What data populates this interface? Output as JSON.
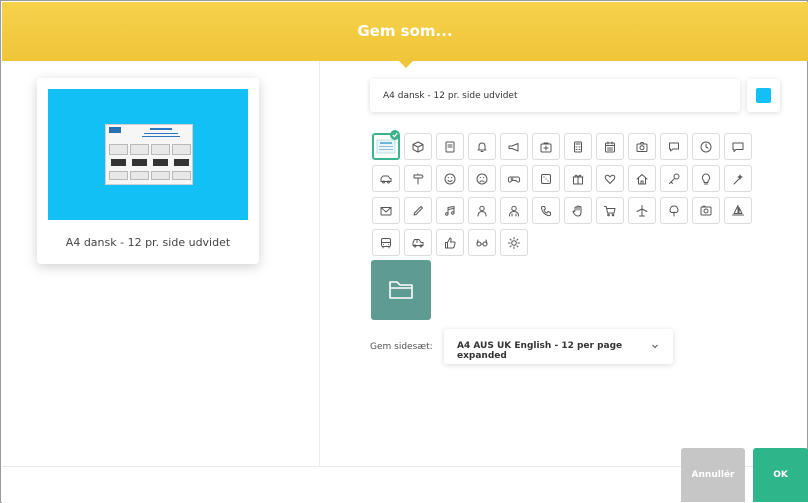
{
  "dialog": {
    "title": "Gem som..."
  },
  "preview": {
    "caption": "A4 dansk - 12 pr. side udvidet",
    "thumb_color": "#12c0f5"
  },
  "name_input": {
    "value": "A4 dansk - 12 pr. side udvidet"
  },
  "color_picker": {
    "selected_color": "#12c0f5"
  },
  "icons": {
    "selected_index": 0,
    "items": [
      "thumbnail-icon",
      "cube-icon",
      "book-icon",
      "bell-icon",
      "megaphone-icon",
      "first-aid-icon",
      "calculator-icon",
      "calendar-icon",
      "camera-icon",
      "chat-icon",
      "clock-icon",
      "speech-bubble-icon",
      "car-icon",
      "signpost-icon",
      "smiley-icon",
      "sad-face-icon",
      "gamepad-icon",
      "dice-icon",
      "gift-icon",
      "heart-icon",
      "house-icon",
      "key-icon",
      "lightbulb-icon",
      "magic-wand-icon",
      "mail-icon",
      "pencil-icon",
      "music-icon",
      "person-icon",
      "people-icon",
      "phone-icon",
      "hand-icon",
      "shopping-cart-icon",
      "airplane-icon",
      "tree-icon",
      "photo-icon",
      "sailboat-icon",
      "bus-icon",
      "car-front-icon",
      "thumbs-up-icon",
      "glasses-icon",
      "sun-icon"
    ]
  },
  "folder": {
    "icon": "folder-icon",
    "color": "#5e9b93"
  },
  "pageset": {
    "label": "Gem sidesæt:",
    "value": "A4 AUS UK English - 12 per page expanded"
  },
  "buttons": {
    "cancel": "Annullér",
    "ok": "OK"
  },
  "colors": {
    "header": "#efc53a",
    "accent": "#2fb58a",
    "cancel": "#c6c6c6"
  }
}
